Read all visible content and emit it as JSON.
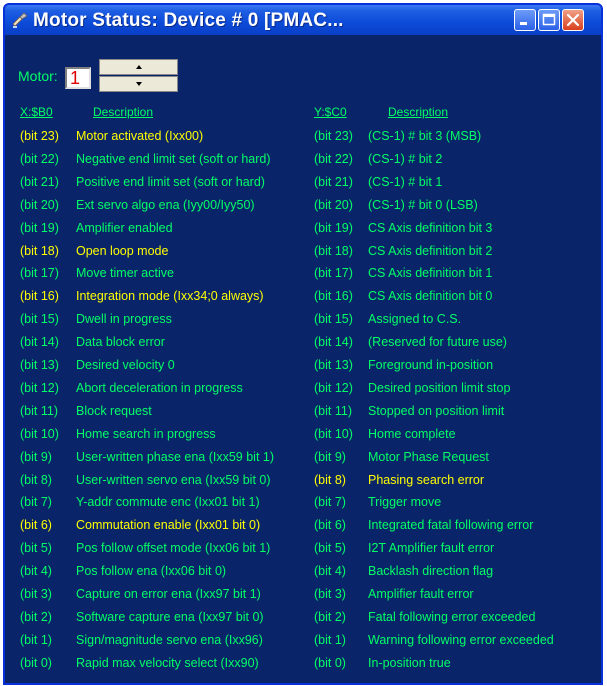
{
  "window": {
    "title": "Motor Status: Device # 0 [PMAC..."
  },
  "controls": {
    "motor_label": "Motor:",
    "motor_value": "1"
  },
  "headers": {
    "x_addr": "X:$B0",
    "x_desc": "Description",
    "y_addr": "Y:$C0",
    "y_desc": "Description"
  },
  "colors": {
    "background": "#0A246A",
    "inactive_text": "#00FF66",
    "active_text": "#FFFF00",
    "titlebar": "#0B4BD8"
  },
  "rows": [
    {
      "x_bit": "(bit 23)",
      "x_desc": "Motor activated (Ixx00)",
      "x_active": true,
      "y_bit": "(bit 23)",
      "y_desc": "(CS-1) # bit 3 (MSB)",
      "y_active": false
    },
    {
      "x_bit": "(bit 22)",
      "x_desc": "Negative end limit set (soft or hard)",
      "x_active": false,
      "y_bit": "(bit 22)",
      "y_desc": "(CS-1) # bit 2",
      "y_active": false
    },
    {
      "x_bit": "(bit 21)",
      "x_desc": "Positive end limit set (soft or hard)",
      "x_active": false,
      "y_bit": "(bit 21)",
      "y_desc": "(CS-1) # bit 1",
      "y_active": false
    },
    {
      "x_bit": "(bit 20)",
      "x_desc": "Ext servo algo ena (Iyy00/Iyy50)",
      "x_active": false,
      "y_bit": "(bit 20)",
      "y_desc": "(CS-1) # bit 0 (LSB)",
      "y_active": false
    },
    {
      "x_bit": "(bit 19)",
      "x_desc": "Amplifier enabled",
      "x_active": false,
      "y_bit": "(bit 19)",
      "y_desc": "CS Axis definition bit 3",
      "y_active": false
    },
    {
      "x_bit": "(bit 18)",
      "x_desc": "Open loop mode",
      "x_active": true,
      "y_bit": "(bit 18)",
      "y_desc": "CS Axis definition bit 2",
      "y_active": false
    },
    {
      "x_bit": "(bit 17)",
      "x_desc": "Move timer active",
      "x_active": false,
      "y_bit": "(bit 17)",
      "y_desc": "CS Axis definition bit 1",
      "y_active": false
    },
    {
      "x_bit": "(bit 16)",
      "x_desc": "Integration mode (Ixx34;0 always)",
      "x_active": true,
      "y_bit": "(bit 16)",
      "y_desc": "CS Axis definition bit 0",
      "y_active": false
    },
    {
      "x_bit": "(bit 15)",
      "x_desc": "Dwell in progress",
      "x_active": false,
      "y_bit": "(bit 15)",
      "y_desc": "Assigned to C.S.",
      "y_active": false
    },
    {
      "x_bit": "(bit 14)",
      "x_desc": "Data block error",
      "x_active": false,
      "y_bit": "(bit 14)",
      "y_desc": "(Reserved for future use)",
      "y_active": false
    },
    {
      "x_bit": "(bit 13)",
      "x_desc": "Desired velocity 0",
      "x_active": false,
      "y_bit": "(bit 13)",
      "y_desc": "Foreground in-position",
      "y_active": false
    },
    {
      "x_bit": "(bit 12)",
      "x_desc": "Abort deceleration in progress",
      "x_active": false,
      "y_bit": "(bit 12)",
      "y_desc": "Desired position limit stop",
      "y_active": false
    },
    {
      "x_bit": "(bit 11)",
      "x_desc": "Block request",
      "x_active": false,
      "y_bit": "(bit 11)",
      "y_desc": "Stopped on position limit",
      "y_active": false
    },
    {
      "x_bit": "(bit 10)",
      "x_desc": "Home search in progress",
      "x_active": false,
      "y_bit": "(bit 10)",
      "y_desc": "Home complete",
      "y_active": false
    },
    {
      "x_bit": "(bit  9)",
      "x_desc": "User-written phase ena (Ixx59 bit 1)",
      "x_active": false,
      "y_bit": "(bit  9)",
      "y_desc": "Motor Phase Request",
      "y_active": false
    },
    {
      "x_bit": "(bit  8)",
      "x_desc": "User-written servo ena (Ixx59 bit 0)",
      "x_active": false,
      "y_bit": "(bit  8)",
      "y_desc": "Phasing search error",
      "y_active": true
    },
    {
      "x_bit": "(bit  7)",
      "x_desc": "Y-addr commute enc (Ixx01 bit 1)",
      "x_active": false,
      "y_bit": "(bit  7)",
      "y_desc": "Trigger move",
      "y_active": false
    },
    {
      "x_bit": "(bit  6)",
      "x_desc": "Commutation enable (Ixx01 bit 0)",
      "x_active": true,
      "y_bit": "(bit  6)",
      "y_desc": "Integrated fatal following error",
      "y_active": false
    },
    {
      "x_bit": "(bit  5)",
      "x_desc": "Pos follow offset mode (Ixx06 bit 1)",
      "x_active": false,
      "y_bit": "(bit  5)",
      "y_desc": "I2T Amplifier fault error",
      "y_active": false
    },
    {
      "x_bit": "(bit  4)",
      "x_desc": "Pos follow ena (Ixx06 bit 0)",
      "x_active": false,
      "y_bit": "(bit  4)",
      "y_desc": "Backlash direction flag",
      "y_active": false
    },
    {
      "x_bit": "(bit  3)",
      "x_desc": "Capture on error ena (Ixx97 bit 1)",
      "x_active": false,
      "y_bit": "(bit  3)",
      "y_desc": "Amplifier fault error",
      "y_active": false
    },
    {
      "x_bit": "(bit  2)",
      "x_desc": "Software capture ena (Ixx97 bit 0)",
      "x_active": false,
      "y_bit": "(bit  2)",
      "y_desc": "Fatal following error exceeded",
      "y_active": false
    },
    {
      "x_bit": "(bit  1)",
      "x_desc": "Sign/magnitude servo ena (Ixx96)",
      "x_active": false,
      "y_bit": "(bit  1)",
      "y_desc": "Warning following error exceeded",
      "y_active": false
    },
    {
      "x_bit": "(bit  0)",
      "x_desc": "Rapid max velocity select (Ixx90)",
      "x_active": false,
      "y_bit": "(bit  0)",
      "y_desc": "In-position true",
      "y_active": false
    }
  ]
}
